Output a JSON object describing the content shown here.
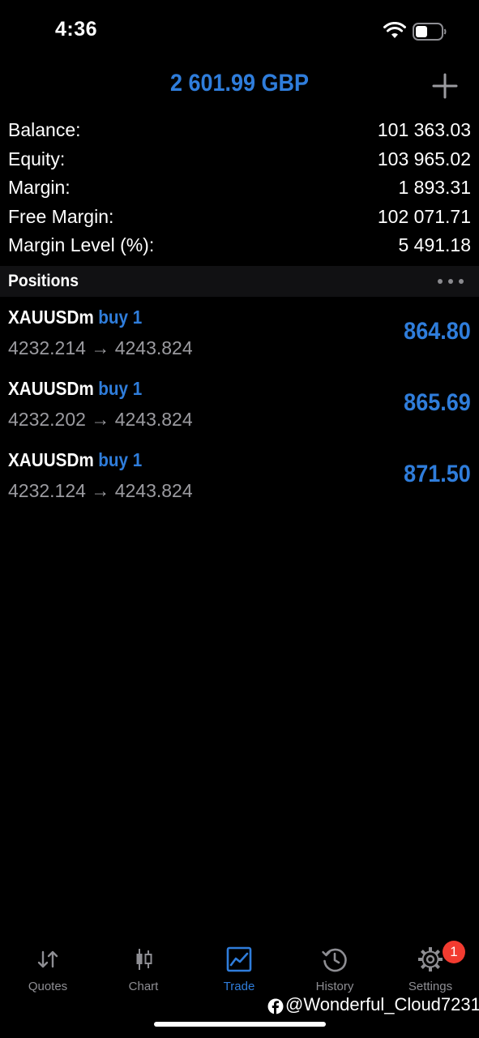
{
  "status_bar": {
    "time": "4:36"
  },
  "header": {
    "balance_display": "2 601.99 GBP",
    "add_icon": "plus-icon"
  },
  "summary": [
    {
      "label": "Balance:",
      "value": "101 363.03"
    },
    {
      "label": "Equity:",
      "value": "103 965.02"
    },
    {
      "label": "Margin:",
      "value": "1 893.31"
    },
    {
      "label": "Free Margin:",
      "value": "102 071.71"
    },
    {
      "label": "Margin Level (%):",
      "value": "5 491.18"
    }
  ],
  "positions_section": {
    "title": "Positions",
    "more_icon": "more-dots-icon"
  },
  "positions": [
    {
      "symbol": "XAUUSDm",
      "type": "buy 1",
      "prices": "4232.214 → 4243.824",
      "profit": "864.80"
    },
    {
      "symbol": "XAUUSDm",
      "type": "buy 1",
      "prices": "4232.202 → 4243.824",
      "profit": "865.69"
    },
    {
      "symbol": "XAUUSDm",
      "type": "buy 1",
      "prices": "4232.124 → 4243.824",
      "profit": "871.50"
    }
  ],
  "tab_bar": {
    "tabs": [
      {
        "label": "Quotes",
        "icon": "quotes-arrows-icon",
        "active": false
      },
      {
        "label": "Chart",
        "icon": "candlestick-icon",
        "active": false
      },
      {
        "label": "Trade",
        "icon": "trade-chart-icon",
        "active": true
      },
      {
        "label": "History",
        "icon": "history-clock-icon",
        "active": false
      },
      {
        "label": "Settings",
        "icon": "gear-icon",
        "active": false,
        "badge": "1"
      }
    ]
  },
  "watermark": {
    "text": "@Wonderful_Cloud7231",
    "icon": "facebook-icon"
  },
  "colors": {
    "accent": "#2f7ddb",
    "background": "#000000",
    "muted_text": "#9b9ba0",
    "badge": "#f23b30"
  }
}
